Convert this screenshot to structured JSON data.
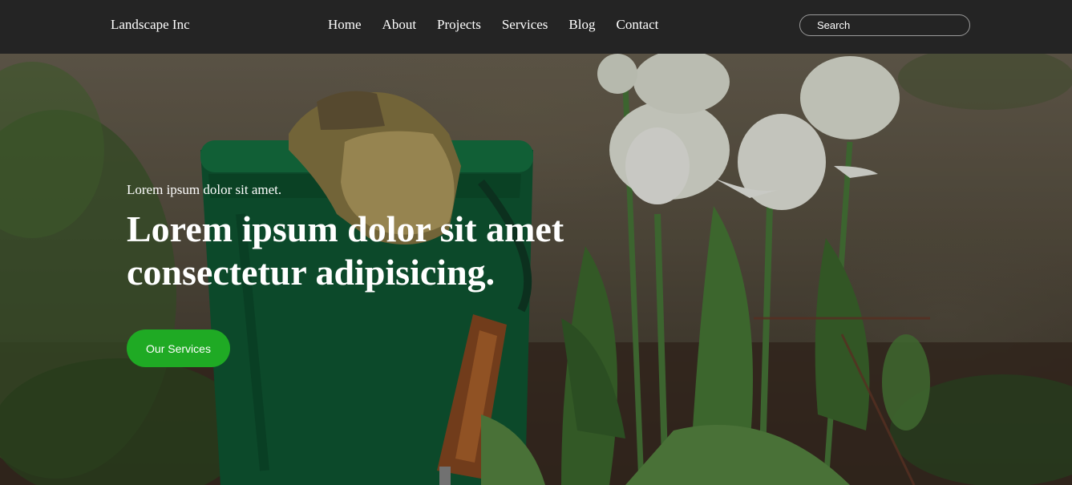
{
  "navbar": {
    "brand": "Landscape Inc",
    "links": [
      "Home",
      "About",
      "Projects",
      "Services",
      "Blog",
      "Contact"
    ],
    "search_placeholder": "Search"
  },
  "hero": {
    "eyebrow": "Lorem ipsum dolor sit amet.",
    "title": "Lorem ipsum dolor sit amet consectetur adipisicing.",
    "cta_label": "Our Services"
  },
  "colors": {
    "navbar_bg": "#242424",
    "cta_bg": "#1faa24",
    "text": "#ffffff"
  }
}
